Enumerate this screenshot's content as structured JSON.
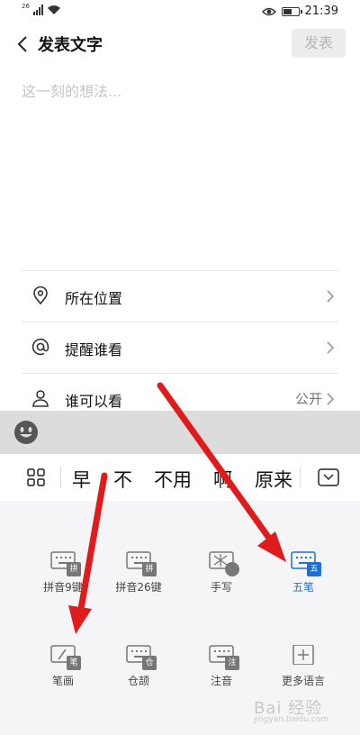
{
  "status_bar": {
    "network": "26",
    "time": "21:39"
  },
  "header": {
    "title": "发表文字",
    "publish_label": "发表"
  },
  "composer": {
    "placeholder": "这一刻的想法..."
  },
  "settings": {
    "location": {
      "label": "所在位置"
    },
    "remind": {
      "label": "提醒谁看"
    },
    "visibility": {
      "label": "谁可以看",
      "value": "公开"
    }
  },
  "keyboard": {
    "candidates": [
      "早",
      "不",
      "不用",
      "啊",
      "原来"
    ],
    "methods": [
      {
        "label": "拼音9键",
        "badge": "拼"
      },
      {
        "label": "拼音26键",
        "badge": "拼"
      },
      {
        "label": "手写",
        "badge": ""
      },
      {
        "label": "五笔",
        "badge": "五"
      },
      {
        "label": "笔画",
        "badge": "笔"
      },
      {
        "label": "仓颉",
        "badge": "仓"
      },
      {
        "label": "注音",
        "badge": "注"
      },
      {
        "label": "更多语言",
        "badge": ""
      }
    ],
    "active_method": "五笔"
  },
  "watermark": {
    "text": "Bai 经验",
    "sub": "jingyan.baidu.com"
  },
  "colors": {
    "accent": "#1e6fd6",
    "arrow": "#e01b1b"
  }
}
